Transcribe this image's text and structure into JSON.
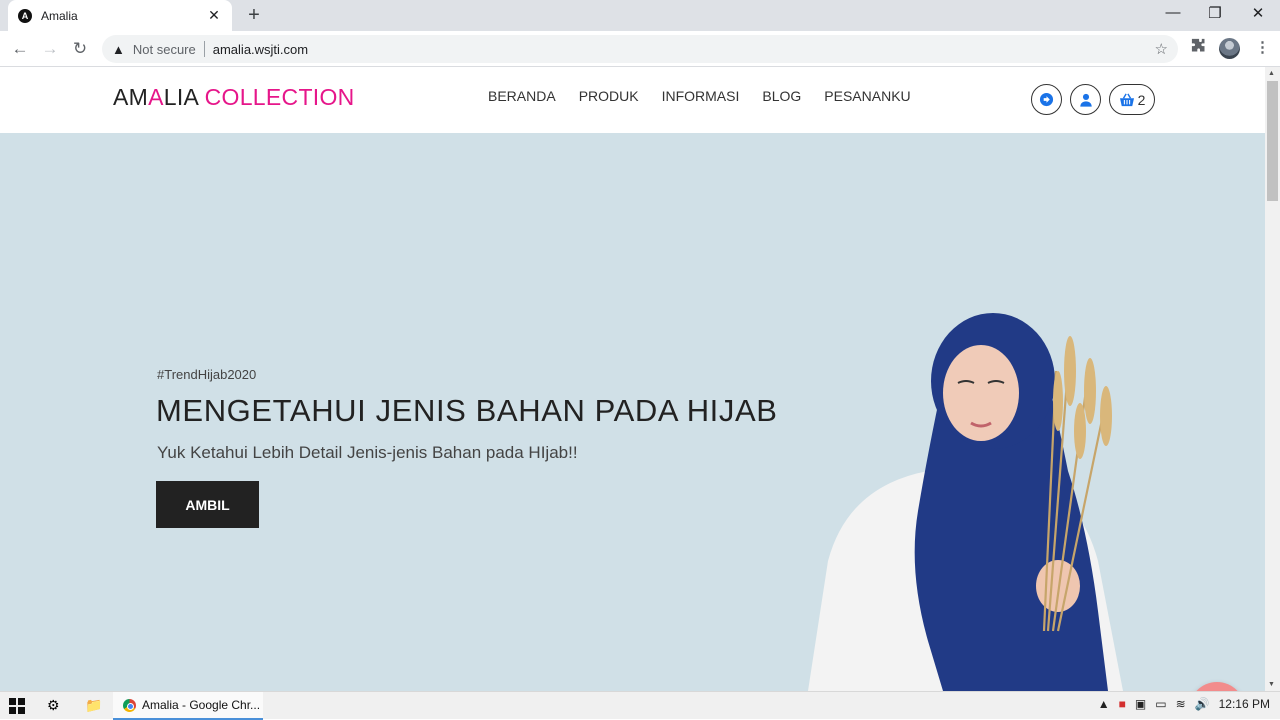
{
  "browser": {
    "tab_title": "Amalia",
    "tab_favicon_letter": "A",
    "new_tab": "+",
    "close": "✕",
    "not_secure": "Not secure",
    "url": "amalia.wsjti.com"
  },
  "site": {
    "logo_part1": "AM",
    "logo_part2": "A",
    "logo_part3": "LIA ",
    "logo_part4": "COLLECTION",
    "nav": [
      "BERANDA",
      "PRODUK",
      "INFORMASI",
      "BLOG",
      "PESANANKU"
    ],
    "cart_count": "2",
    "colors": {
      "brand_pink": "#e6168a",
      "icon_blue": "#1a73e8",
      "hero_bg": "#d0e0e7",
      "chat_bubble": "#f28c8c"
    }
  },
  "hero": {
    "tag": "#TrendHijab2020",
    "headline": "MENGETAHUI JENIS BAHAN PADA HIJAB",
    "subline": "Yuk Ketahui Lebih Detail Jenis-jenis Bahan pada HIjab!!",
    "button": "AMBIL"
  },
  "taskbar": {
    "chrome_label": "Amalia - Google Chr...",
    "time": "12:16 PM"
  }
}
